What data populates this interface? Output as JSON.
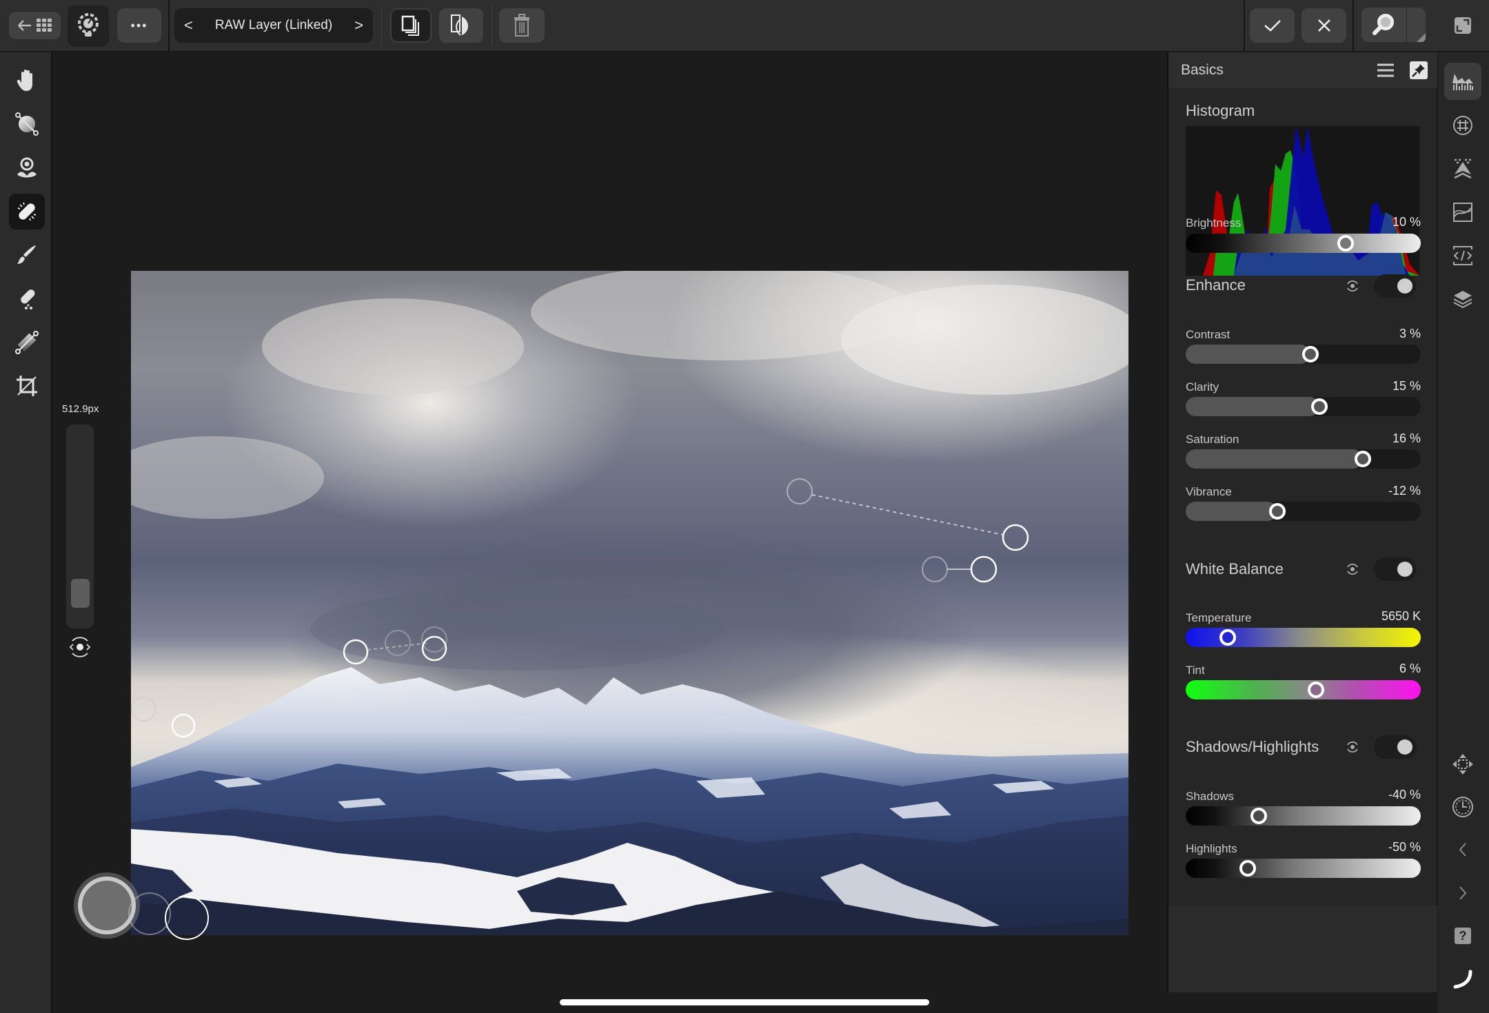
{
  "toolbar": {
    "layer_name": "RAW Layer (Linked)",
    "prev_layer_label": "<",
    "next_layer_label": ">",
    "more_label": "•••",
    "icons": [
      "back-to-gallery-icon",
      "persona-lightbulb-icon",
      "more-icon",
      "layers-stack-icon",
      "mask-compare-icon",
      "trash-icon",
      "apply-check-icon",
      "cancel-x-icon",
      "zoom-magnifier-icon",
      "fullscreen-exit-icon"
    ]
  },
  "left_tools": [
    {
      "name": "view-hand-tool",
      "active": false
    },
    {
      "name": "red-eye-tool",
      "active": false
    },
    {
      "name": "overlay-tool",
      "active": false
    },
    {
      "name": "healing-bandage-tool",
      "active": true
    },
    {
      "name": "paint-brush-tool",
      "active": false
    },
    {
      "name": "inpainting-tool",
      "active": false
    },
    {
      "name": "gradient-tool",
      "active": false
    },
    {
      "name": "crop-tool",
      "active": false
    }
  ],
  "brush": {
    "size_label": "512.9px",
    "size_fraction": 0.08
  },
  "panel": {
    "title": "Basics",
    "histogram_title": "Histogram",
    "brightness": {
      "label": "Brightness",
      "value": "10 %",
      "position": 0.68
    },
    "enhance": {
      "title": "Enhance",
      "enabled": true,
      "sliders": [
        {
          "label": "Contrast",
          "value": "3 %",
          "position": 0.53
        },
        {
          "label": "Clarity",
          "value": "15 %",
          "position": 0.57
        },
        {
          "label": "Saturation",
          "value": "16 %",
          "position": 0.755
        },
        {
          "label": "Vibrance",
          "value": "-12 %",
          "position": 0.39
        }
      ]
    },
    "white_balance": {
      "title": "White Balance",
      "enabled": true,
      "temperature": {
        "label": "Temperature",
        "value": "5650 K",
        "position": 0.18
      },
      "tint": {
        "label": "Tint",
        "value": "6 %",
        "position": 0.555
      }
    },
    "shadows_highlights": {
      "title": "Shadows/Highlights",
      "enabled": true,
      "shadows": {
        "label": "Shadows",
        "value": "-40 %",
        "position": 0.31
      },
      "highlights": {
        "label": "Highlights",
        "value": "-50 %",
        "position": 0.265
      }
    }
  },
  "right_column": {
    "icons": [
      "histogram-studio-icon",
      "channels-icon",
      "develop-icon",
      "curves-icon",
      "code-icon",
      "layers-icon",
      "move-icon",
      "history-clock-icon",
      "chevron-left-icon",
      "chevron-right-icon",
      "help-icon",
      "brush-curve-icon"
    ],
    "help_label": "?"
  },
  "colors": {
    "topbar": "#2e2e2e",
    "canvas": "#1c1c1c",
    "panel": "#262626",
    "temperature_start": "#1010f0",
    "temperature_end": "#f5f500",
    "tint_start": "#10ff10",
    "tint_end": "#ff10f0"
  }
}
